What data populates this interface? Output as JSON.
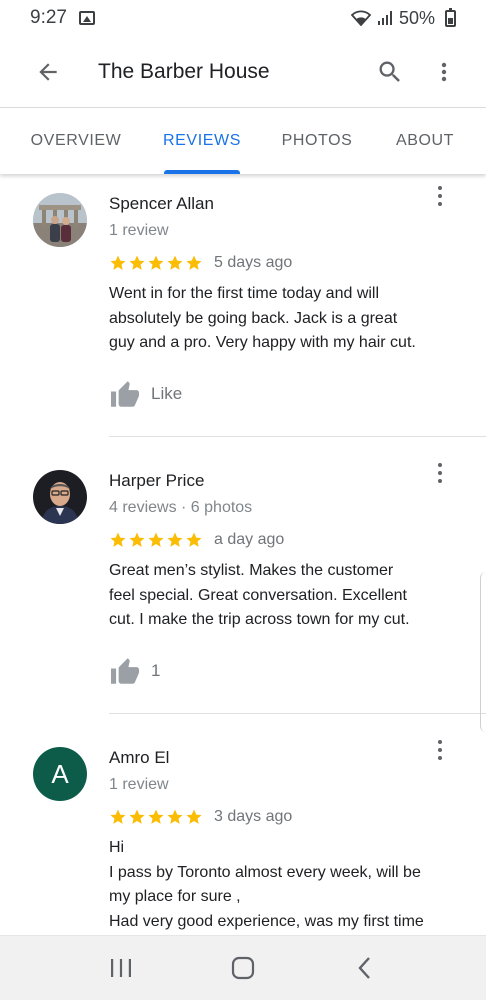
{
  "status_bar": {
    "time": "9:27",
    "battery": "50%"
  },
  "app_bar": {
    "title": "The Barber House"
  },
  "tabs": [
    {
      "label": "OVERVIEW"
    },
    {
      "label": "REVIEWS",
      "active": true
    },
    {
      "label": "PHOTOS"
    },
    {
      "label": "ABOUT"
    }
  ],
  "reviews": [
    {
      "name": "Spencer Allan",
      "meta": "1 review",
      "rating": 5,
      "date": "5 days ago",
      "text": "Went in for the first time today and will\nabsolutely be going back. Jack is a great\nguy and a pro. Very happy with my hair cut.",
      "like_label": "Like"
    },
    {
      "name": "Harper Price",
      "meta": "4 reviews · 6 photos",
      "rating": 5,
      "date": "a day ago",
      "text": "Great men’s stylist.  Makes the customer\nfeel special. Great conversation.  Excellent\ncut. I make the trip across town for my cut.",
      "like_label": "1"
    },
    {
      "name": "Amro El",
      "meta": "1 review",
      "rating": 5,
      "date": "3 days ago",
      "avatar_letter": "A",
      "text": "Hi\nI pass by Toronto almost every week, will be\nmy place for sure ,\nHad very good experience, was my first time"
    }
  ],
  "colors": {
    "accent": "#1a73e8",
    "star": "#fbbc04",
    "avatar_green": "#0d5c4a"
  }
}
